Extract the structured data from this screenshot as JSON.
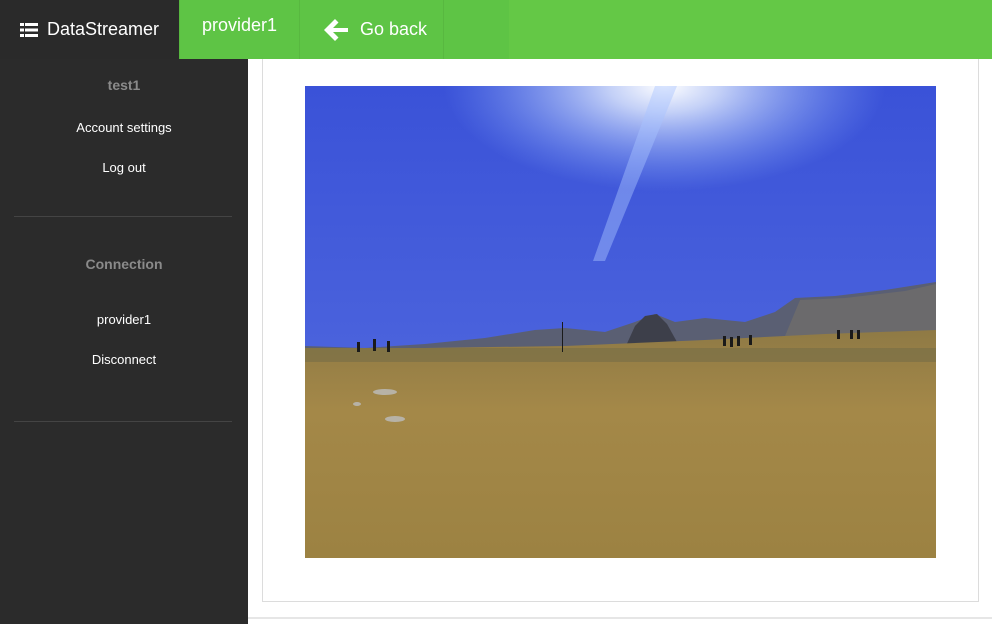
{
  "topbar": {
    "brand": "DataStreamer",
    "brand_icon": "list-icon",
    "provider": "provider1",
    "go_back": "Go back",
    "go_back_icon": "arrow-left-icon",
    "accent_color": "#5ec445",
    "brand_bg": "#2a2a2a"
  },
  "sidebar": {
    "username": "test1",
    "account_settings": "Account settings",
    "log_out": "Log out",
    "connection_heading": "Connection",
    "provider": "provider1",
    "disconnect": "Disconnect"
  },
  "content": {
    "image": "landscape-photo"
  }
}
